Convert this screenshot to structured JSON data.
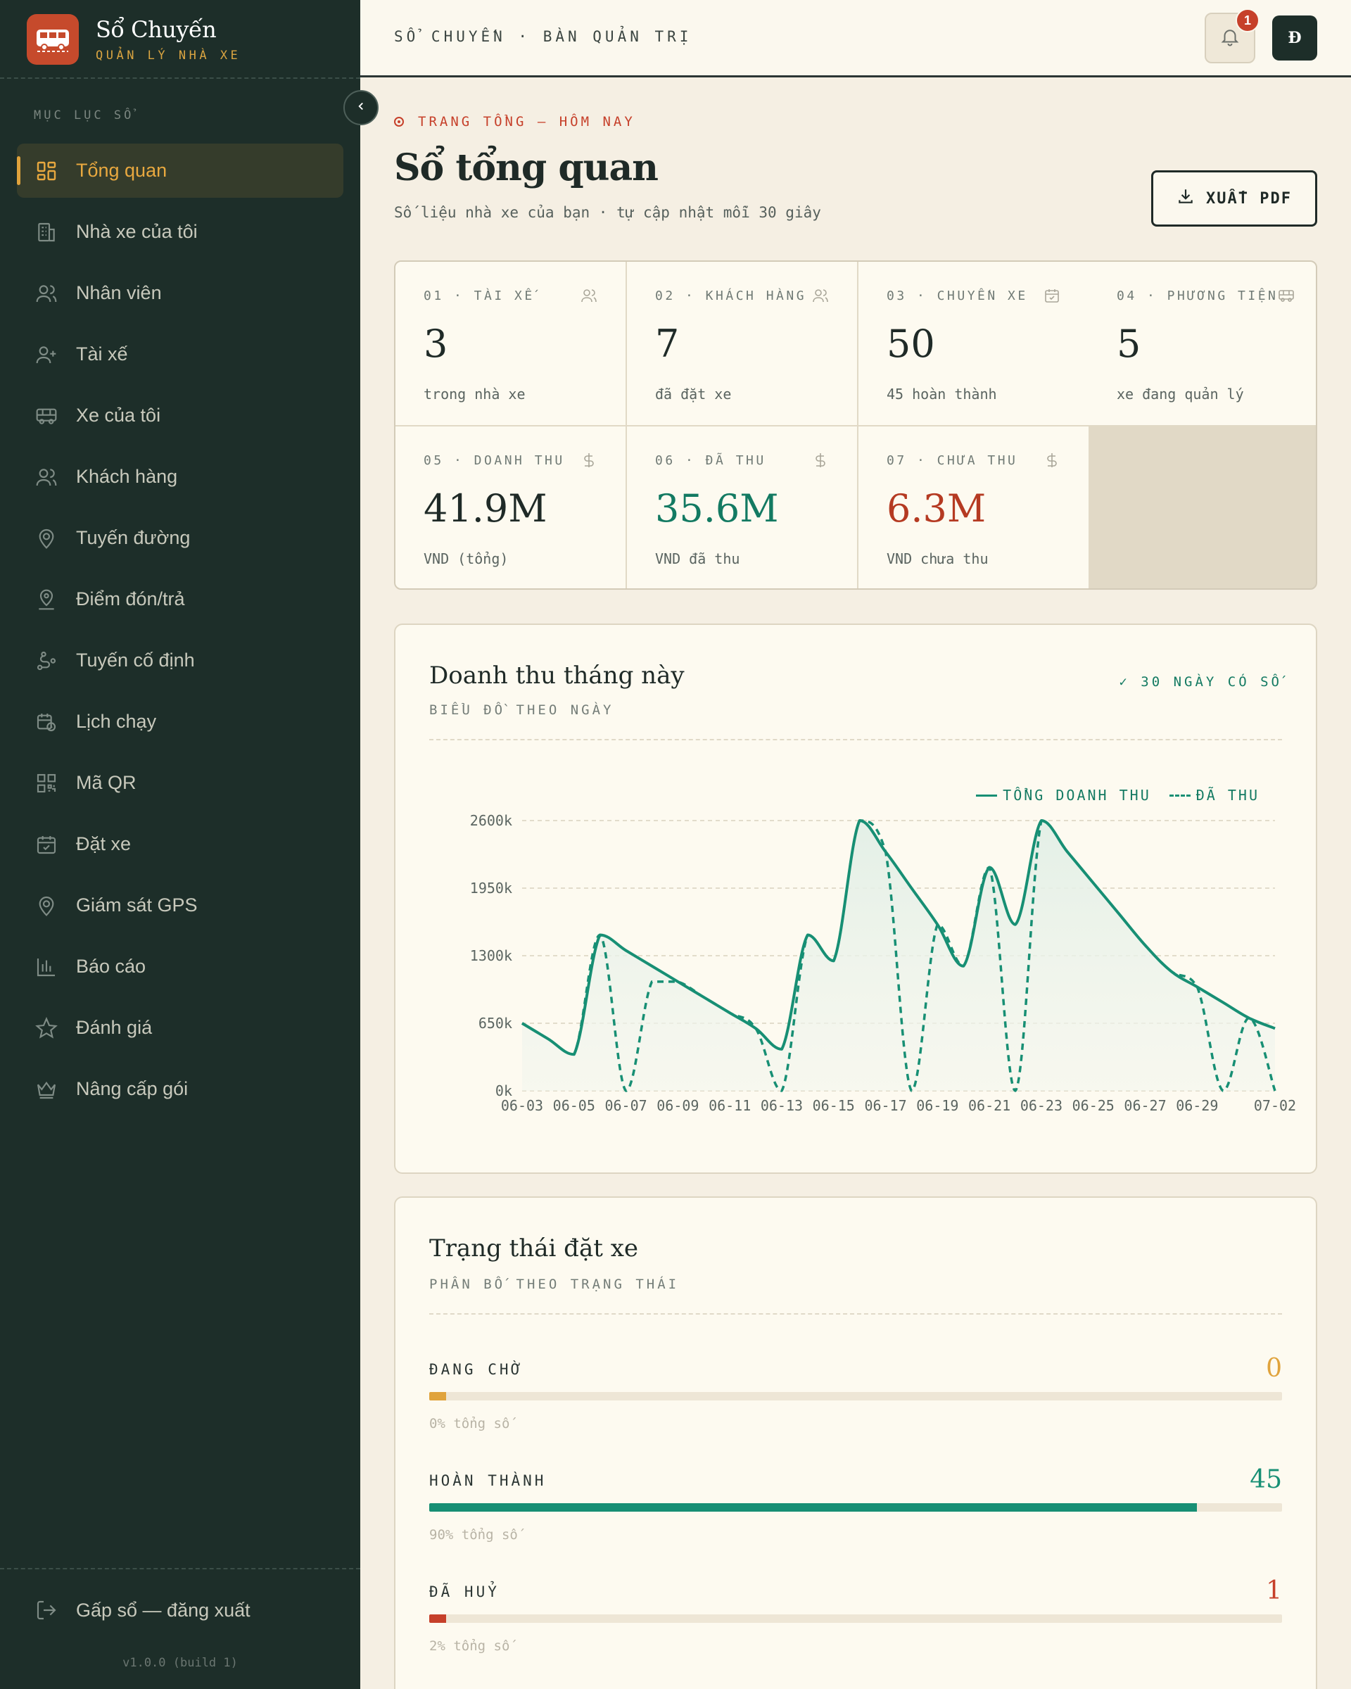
{
  "brand": {
    "title": "Sổ Chuyến",
    "subtitle": "QUẢN LÝ NHÀ XE"
  },
  "sidebar": {
    "section_label": "MỤC LỤC SỔ",
    "items": [
      {
        "label": "Tổng quan",
        "icon": "grid-icon",
        "active": true
      },
      {
        "label": "Nhà xe của tôi",
        "icon": "building-icon"
      },
      {
        "label": "Nhân viên",
        "icon": "users-icon"
      },
      {
        "label": "Tài xế",
        "icon": "user-plus-icon"
      },
      {
        "label": "Xe của tôi",
        "icon": "bus-icon"
      },
      {
        "label": "Khách hàng",
        "icon": "users-icon"
      },
      {
        "label": "Tuyến đường",
        "icon": "map-pin-icon"
      },
      {
        "label": "Điểm đón/trả",
        "icon": "pin-user-icon"
      },
      {
        "label": "Tuyến cố định",
        "icon": "route-icon"
      },
      {
        "label": "Lịch chạy",
        "icon": "calendar-clock-icon"
      },
      {
        "label": "Mã QR",
        "icon": "qr-icon"
      },
      {
        "label": "Đặt xe",
        "icon": "calendar-check-icon"
      },
      {
        "label": "Giám sát GPS",
        "icon": "map-pin-icon"
      },
      {
        "label": "Báo cáo",
        "icon": "bar-chart-icon"
      },
      {
        "label": "Đánh giá",
        "icon": "star-icon"
      },
      {
        "label": "Nâng cấp gói",
        "icon": "crown-icon"
      }
    ],
    "logout_label": "Gấp sổ — đăng xuất",
    "version": "v1.0.0 (build 1)"
  },
  "topbar": {
    "breadcrumb": "SỔ CHUYẾN · BÀN QUẢN TRỊ",
    "notification_count": "1",
    "avatar_initial": "Đ"
  },
  "header": {
    "eyebrow": "TRANG TỔNG — HÔM NAY",
    "title": "Sổ tổng quan",
    "subtitle": "Số liệu nhà xe của bạn · tự cập nhật mỗi 30 giây",
    "export_label": "XUẤT PDF"
  },
  "stats": [
    {
      "label": "01 · TÀI XẾ",
      "value": "3",
      "note": "trong nhà xe",
      "icon": "users-icon"
    },
    {
      "label": "02 · KHÁCH HÀNG",
      "value": "7",
      "note": "đã đặt xe",
      "icon": "users-icon"
    },
    {
      "label": "03 · CHUYẾN XE",
      "value": "50",
      "note": "45 hoàn thành",
      "icon": "calendar-check-icon"
    },
    {
      "label": "04 · PHƯƠNG TIỆN",
      "value": "5",
      "note": "xe đang quản lý",
      "icon": "bus-icon"
    },
    {
      "label": "05 · DOANH THU",
      "value": "41.9M",
      "note": "VND (tổng)",
      "icon": "dollar-icon"
    },
    {
      "label": "06 · ĐÃ THU",
      "value": "35.6M",
      "note": "VND đã thu",
      "icon": "dollar-icon"
    },
    {
      "label": "07 · CHƯA THU",
      "value": "6.3M",
      "note": "VND chưa thu",
      "icon": "dollar-icon"
    }
  ],
  "revenue_card": {
    "title": "Doanh thu tháng này",
    "subtitle": "BIỂU ĐỒ THEO NGÀY",
    "badge": "✓ 30 NGÀY CÓ SỐ"
  },
  "chart_data": {
    "type": "line",
    "title": "Doanh thu tháng này",
    "xlabel": "",
    "ylabel": "",
    "ylim": [
      0,
      2600
    ],
    "y_ticks": [
      "0k",
      "650k",
      "1300k",
      "1950k",
      "2600k"
    ],
    "x_ticks": [
      "06-03",
      "06-05",
      "06-07",
      "06-09",
      "06-11",
      "06-13",
      "06-15",
      "06-17",
      "06-19",
      "06-21",
      "06-23",
      "06-25",
      "06-27",
      "06-29",
      "07-02"
    ],
    "x": [
      "06-03",
      "06-04",
      "06-05",
      "06-06",
      "06-07",
      "06-08",
      "06-09",
      "06-10",
      "06-11",
      "06-12",
      "06-13",
      "06-14",
      "06-15",
      "06-16",
      "06-17",
      "06-18",
      "06-19",
      "06-20",
      "06-21",
      "06-22",
      "06-23",
      "06-24",
      "06-25",
      "06-26",
      "06-27",
      "06-28",
      "06-29",
      "06-30",
      "07-01",
      "07-02"
    ],
    "series": [
      {
        "name": "TỔNG DOANH THU",
        "style": "solid",
        "values": [
          650,
          500,
          350,
          1500,
          1350,
          1200,
          1050,
          900,
          750,
          600,
          400,
          1500,
          1250,
          2600,
          2300,
          1950,
          1600,
          1200,
          2150,
          1600,
          2600,
          2300,
          2000,
          1700,
          1400,
          1150,
          1000,
          850,
          700,
          600
        ]
      },
      {
        "name": "ĐÃ THU",
        "style": "dashed",
        "values": [
          650,
          500,
          350,
          1500,
          0,
          1050,
          1050,
          900,
          750,
          600,
          0,
          1500,
          1250,
          2600,
          2300,
          0,
          1600,
          1200,
          2150,
          0,
          2600,
          2300,
          2000,
          1700,
          1400,
          1150,
          1000,
          0,
          700,
          0
        ]
      }
    ],
    "colors": {
      "line": "#178f74",
      "fill": "#e6f1ea"
    },
    "grid": true,
    "legend": "top-right"
  },
  "status_card": {
    "title": "Trạng thái đặt xe",
    "subtitle": "PHÂN BỐ THEO TRẠNG THÁI",
    "rows": [
      {
        "label": "ĐANG CHỜ",
        "count": "0",
        "pct_text": "0% tổng số",
        "fraction": 0.02,
        "color": "#e0a33c"
      },
      {
        "label": "HOÀN THÀNH",
        "count": "45",
        "pct_text": "90% tổng số",
        "fraction": 0.9,
        "color": "#178f74"
      },
      {
        "label": "ĐÃ HUỶ",
        "count": "1",
        "pct_text": "2% tổng số",
        "fraction": 0.02,
        "color": "#c6402a"
      }
    ]
  }
}
